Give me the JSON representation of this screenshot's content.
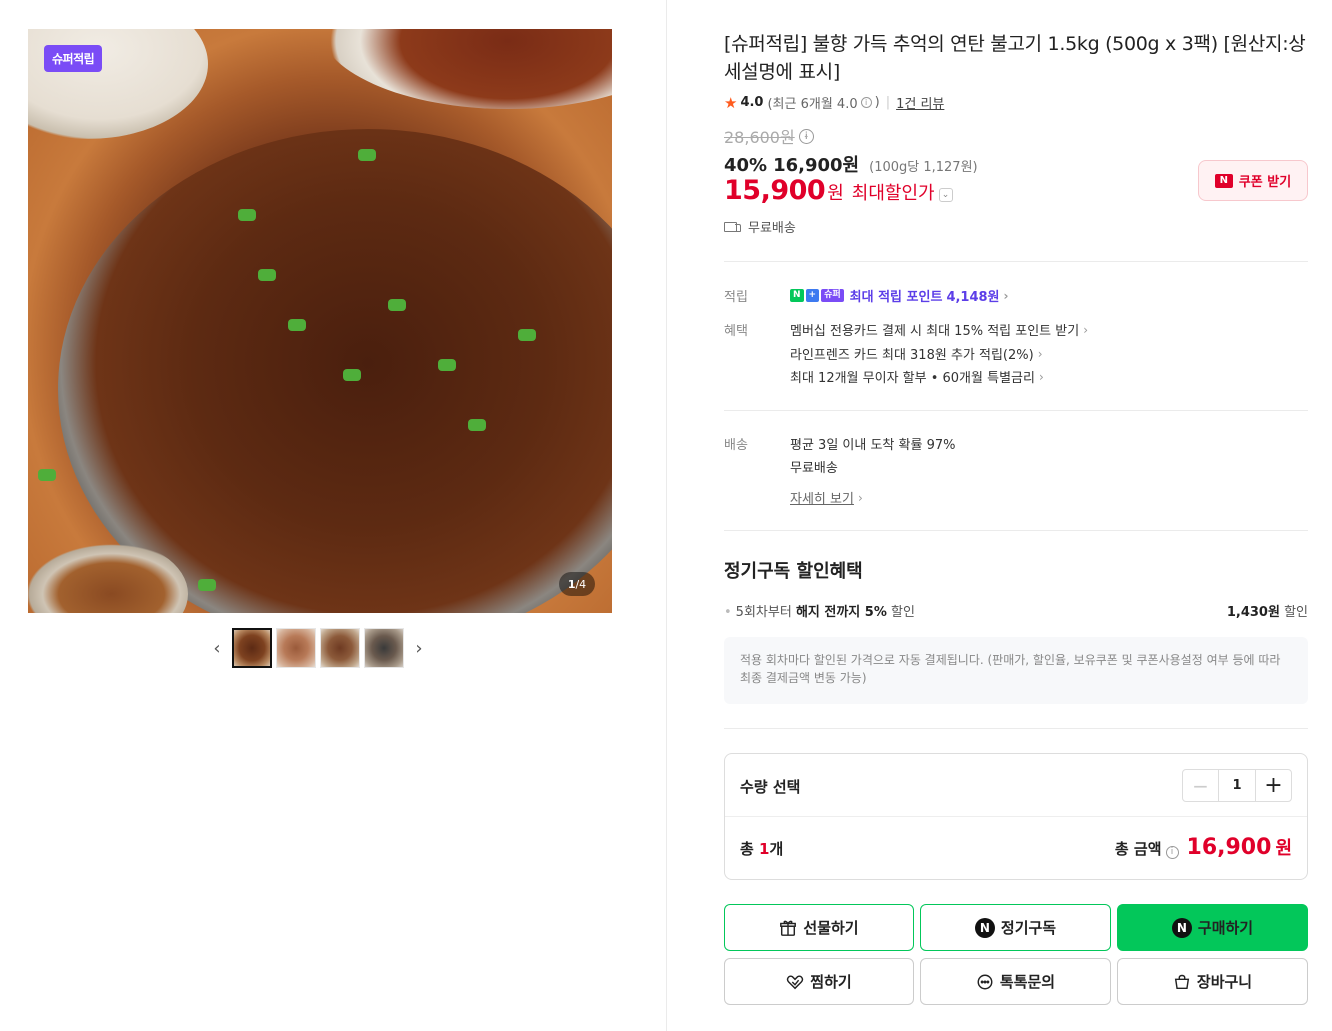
{
  "gallery": {
    "badge": "슈퍼적립",
    "counter_current": "1",
    "counter_total": "/4",
    "prev_arrow": "‹",
    "next_arrow": "›"
  },
  "product": {
    "title": "[슈퍼적립] 불향 가득 추억의 연탄 불고기 1.5kg (500g x 3팩) [원산지:상세설명에 표시]",
    "rating": "4.0",
    "rating_recent": "(최근 6개월 4.0",
    "rating_recent_close": ")",
    "review_link": "1건 리뷰",
    "original_price": "28,600원",
    "discount_rate": "40%",
    "sale_price": "16,900원",
    "unit_price": "(100g당 1,127원)",
    "max_price": "15,900",
    "max_won": "원",
    "max_label": "최대할인가",
    "coupon_button": "쿠폰 받기",
    "shipping": "무료배송"
  },
  "benefits": {
    "point_label": "적립",
    "point_text": "최대 적립 포인트",
    "point_value": "4,148원",
    "benefit_label": "혜택",
    "benefit_items": [
      "멤버십 전용카드 결제 시 최대 15% 적립 포인트 받기",
      "라인프렌즈 카드 최대 318원 추가 적립(2%)",
      "최대 12개월 무이자 할부 • 60개월 특별금리"
    ],
    "delivery_label": "배송",
    "delivery_items": [
      "평균 3일 이내 도착 확률 97%",
      "무료배송"
    ],
    "detail_link": "자세히 보기"
  },
  "subscription": {
    "title": "정기구독 할인혜택",
    "condition_prefix": "5회차부터",
    "condition_bold": "해지 전까지 5%",
    "condition_suffix": "할인",
    "amount": "1,430원",
    "amount_suffix": "할인",
    "note": "적용 회차마다 할인된 가격으로 자동 결제됩니다. (판매가, 할인율, 보유쿠폰 및 쿠폰사용설정 여부 등에 따라 최종 결제금액 변동 가능)"
  },
  "quantity": {
    "label": "수량 선택",
    "value": "1",
    "total_prefix": "총",
    "total_count": "1",
    "total_unit": "개",
    "total_label": "총 금액",
    "total_price": "16,900",
    "total_won": "원"
  },
  "actions": {
    "gift": "선물하기",
    "subscribe": "정기구독",
    "buy": "구매하기",
    "wish": "찜하기",
    "talk": "톡톡문의",
    "cart": "장바구니"
  },
  "colors": {
    "accent_red": "#e0002a",
    "naver_green": "#03c75a",
    "super_purple": "#7a4cf6"
  }
}
